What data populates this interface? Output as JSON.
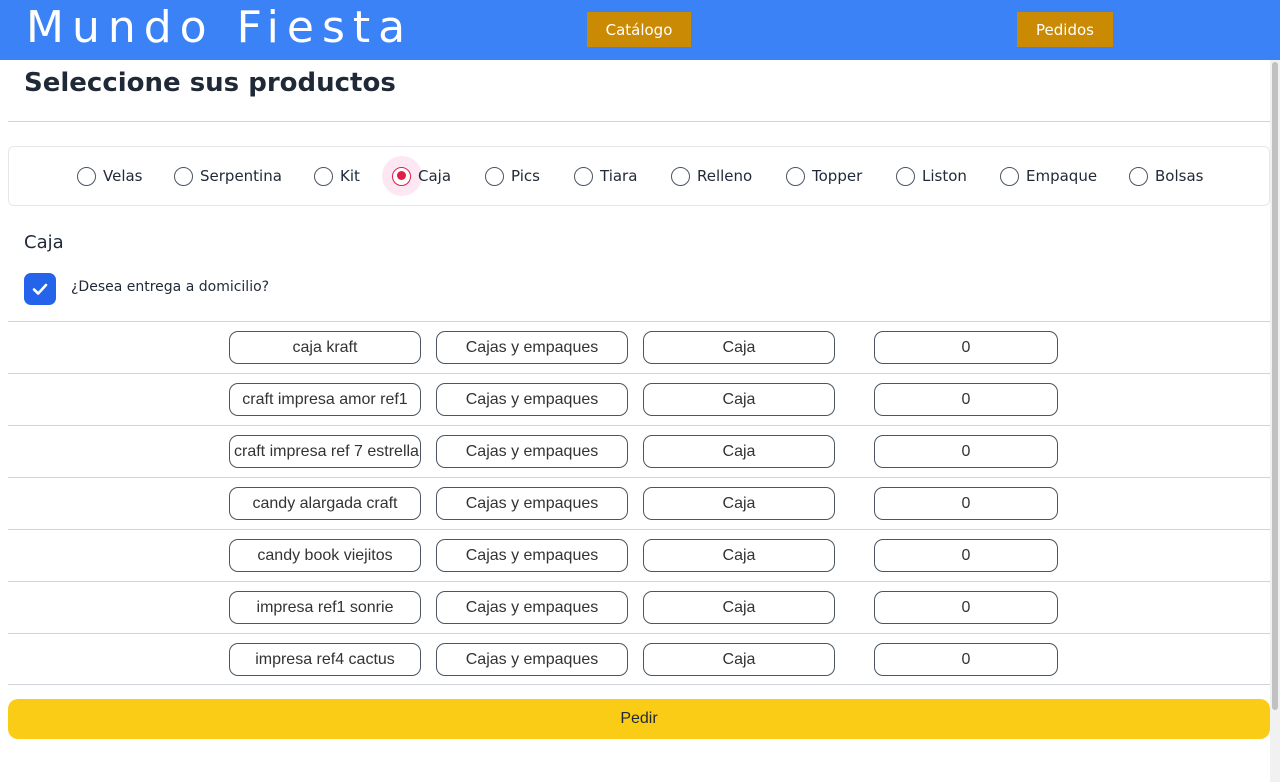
{
  "header": {
    "brand": "Mundo Fiesta",
    "nav": {
      "catalogo": "Catálogo",
      "pedidos": "Pedidos"
    },
    "bg_color": "#3b82f6",
    "nav_color": "#ca8a04"
  },
  "main": {
    "title": "Seleccione sus productos",
    "categories": [
      {
        "label": "Velas",
        "selected": false
      },
      {
        "label": "Serpentina",
        "selected": false
      },
      {
        "label": "Kit",
        "selected": false
      },
      {
        "label": "Caja",
        "selected": true
      },
      {
        "label": "Pics",
        "selected": false
      },
      {
        "label": "Tiara",
        "selected": false
      },
      {
        "label": "Relleno",
        "selected": false
      },
      {
        "label": "Topper",
        "selected": false
      },
      {
        "label": "Liston",
        "selected": false
      },
      {
        "label": "Empaque",
        "selected": false
      },
      {
        "label": "Bolsas",
        "selected": false
      }
    ],
    "section_title": "Caja",
    "delivery": {
      "label": "¿Desea entrega a domicilio?",
      "checked": true
    },
    "products": [
      {
        "name": "caja kraft",
        "category": "Cajas y empaques",
        "type": "Caja",
        "qty": "0"
      },
      {
        "name": "craft impresa amor ref1",
        "category": "Cajas y empaques",
        "type": "Caja",
        "qty": "0"
      },
      {
        "name": "craft impresa ref 7 estrella",
        "category": "Cajas y empaques",
        "type": "Caja",
        "qty": "0"
      },
      {
        "name": "candy alargada craft",
        "category": "Cajas y empaques",
        "type": "Caja",
        "qty": "0"
      },
      {
        "name": "candy book viejitos",
        "category": "Cajas y empaques",
        "type": "Caja",
        "qty": "0"
      },
      {
        "name": "impresa ref1 sonrie",
        "category": "Cajas y empaques",
        "type": "Caja",
        "qty": "0"
      },
      {
        "name": "impresa ref4 cactus",
        "category": "Cajas y empaques",
        "type": "Caja",
        "qty": "0"
      }
    ],
    "submit_label": "Pedir",
    "submit_color": "#facc15",
    "accent_color": "#e11d48",
    "checkbox_color": "#2563eb"
  }
}
